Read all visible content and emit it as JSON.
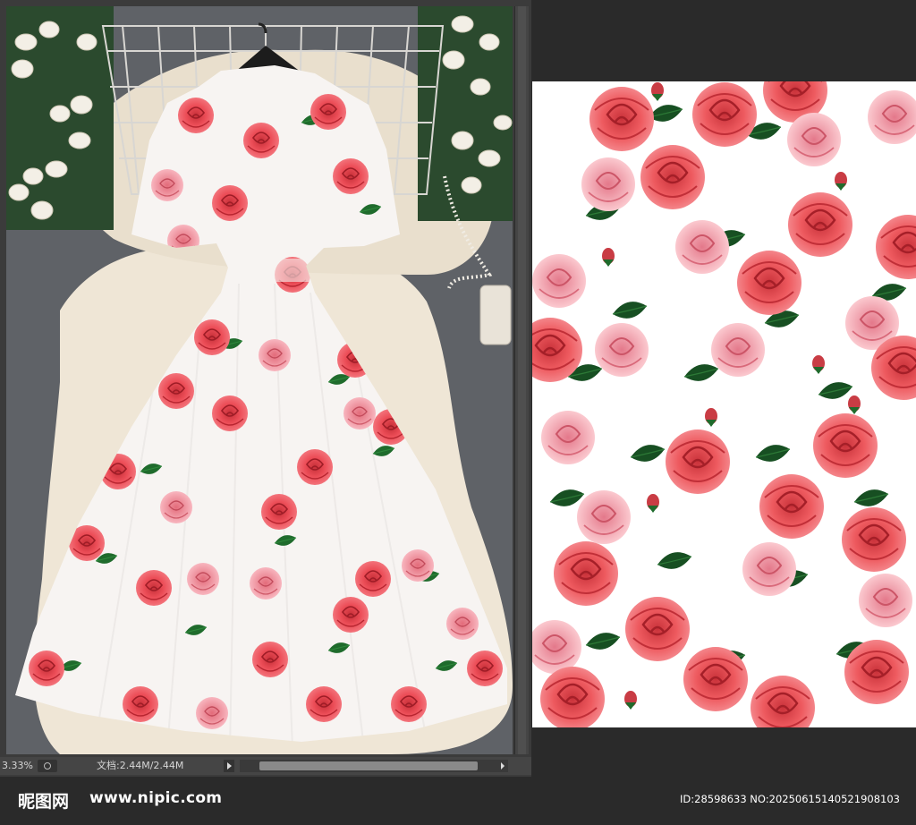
{
  "status_bar": {
    "zoom": "3.33%",
    "doc_info": "文档:2.44M/2.44M"
  },
  "watermark": {
    "logo": "昵图网",
    "url": "www.nipic.com",
    "id_text": "ID:28598633 NO:20250615140521908103"
  },
  "colors": {
    "rose_red": "#e8454c",
    "rose_pink": "#f7a3ad",
    "leaf_green": "#1f6b2c",
    "fabric_white": "#f7f4f2",
    "fur": "#efe6d6"
  }
}
